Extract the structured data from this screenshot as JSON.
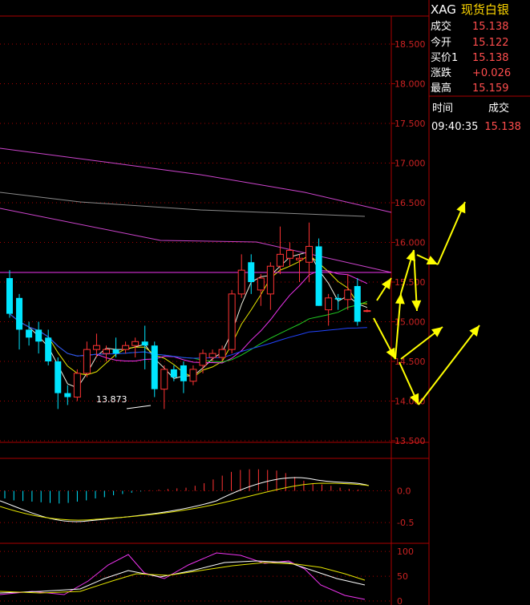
{
  "quote_panel": {
    "code": "XAG",
    "name": "现货白银",
    "fields": [
      {
        "label": "成交",
        "value": "15.138"
      },
      {
        "label": "今开",
        "value": "15.122"
      },
      {
        "label": "买价1",
        "value": "15.138"
      },
      {
        "label": "涨跌",
        "value": "+0.026"
      },
      {
        "label": "最高",
        "value": "15.159"
      }
    ],
    "ticks_header": {
      "time": "时间",
      "price": "成交"
    },
    "ticks": [
      {
        "time": "09:40:35",
        "price": "15.138"
      }
    ]
  },
  "colors": {
    "up": "#ff3333",
    "down": "#00e5ff",
    "grid": "#aa0000",
    "axis_text": "#cc2222",
    "ma_white": "#f0f0e0",
    "ma_yellow": "#e6e600",
    "ma_magenta": "#ee33ee",
    "ma_green": "#22cc22",
    "ma_blue": "#2244ff",
    "ma_gray": "#8a8a8a",
    "ma_pink": "#cc44cc",
    "arrow": "#ffff00"
  },
  "chart_data": [
    {
      "type": "candlestick",
      "yticks": [
        "18.500",
        "18.000",
        "17.500",
        "17.000",
        "16.500",
        "16.000",
        "15.500",
        "15.000",
        "14.500",
        "14.000",
        "13.500"
      ],
      "ylim": [
        13.5,
        18.5
      ],
      "annotation": "13.873",
      "candles": [
        {
          "o": 15.55,
          "h": 15.65,
          "l": 15.05,
          "c": 15.1
        },
        {
          "o": 15.3,
          "h": 15.35,
          "l": 14.65,
          "c": 14.9
        },
        {
          "o": 14.9,
          "h": 15.0,
          "l": 14.7,
          "c": 14.8
        },
        {
          "o": 14.9,
          "h": 15.0,
          "l": 14.6,
          "c": 14.75
        },
        {
          "o": 14.8,
          "h": 14.9,
          "l": 14.45,
          "c": 14.5
        },
        {
          "o": 14.5,
          "h": 14.55,
          "l": 13.9,
          "c": 14.1
        },
        {
          "o": 14.1,
          "h": 14.2,
          "l": 13.95,
          "c": 14.05
        },
        {
          "o": 14.05,
          "h": 14.4,
          "l": 14.0,
          "c": 14.35
        },
        {
          "o": 14.35,
          "h": 14.75,
          "l": 14.3,
          "c": 14.65
        },
        {
          "o": 14.65,
          "h": 14.85,
          "l": 14.55,
          "c": 14.7
        },
        {
          "o": 14.6,
          "h": 14.7,
          "l": 14.5,
          "c": 14.65
        },
        {
          "o": 14.65,
          "h": 14.8,
          "l": 14.55,
          "c": 14.6
        },
        {
          "o": 14.65,
          "h": 14.75,
          "l": 14.6,
          "c": 14.7
        },
        {
          "o": 14.7,
          "h": 14.8,
          "l": 14.55,
          "c": 14.75
        },
        {
          "o": 14.75,
          "h": 14.95,
          "l": 14.4,
          "c": 14.7
        },
        {
          "o": 14.7,
          "h": 14.75,
          "l": 14.05,
          "c": 14.15
        },
        {
          "o": 14.15,
          "h": 14.45,
          "l": 13.9,
          "c": 14.4
        },
        {
          "o": 14.4,
          "h": 14.45,
          "l": 14.25,
          "c": 14.3
        },
        {
          "o": 14.45,
          "h": 14.5,
          "l": 14.1,
          "c": 14.25
        },
        {
          "o": 14.25,
          "h": 14.45,
          "l": 14.2,
          "c": 14.4
        },
        {
          "o": 14.45,
          "h": 14.65,
          "l": 14.35,
          "c": 14.6
        },
        {
          "o": 14.55,
          "h": 14.65,
          "l": 14.5,
          "c": 14.6
        },
        {
          "o": 14.55,
          "h": 14.7,
          "l": 14.5,
          "c": 14.65
        },
        {
          "o": 14.65,
          "h": 15.4,
          "l": 14.6,
          "c": 15.35
        },
        {
          "o": 15.35,
          "h": 15.85,
          "l": 15.3,
          "c": 15.65
        },
        {
          "o": 15.75,
          "h": 15.85,
          "l": 15.35,
          "c": 15.5
        },
        {
          "o": 15.4,
          "h": 15.6,
          "l": 15.2,
          "c": 15.55
        },
        {
          "o": 15.35,
          "h": 15.75,
          "l": 15.15,
          "c": 15.7
        },
        {
          "o": 15.7,
          "h": 16.2,
          "l": 15.6,
          "c": 15.85
        },
        {
          "o": 15.8,
          "h": 16.0,
          "l": 15.7,
          "c": 15.9
        },
        {
          "o": 15.78,
          "h": 15.85,
          "l": 15.5,
          "c": 15.8
        },
        {
          "o": 15.75,
          "h": 16.25,
          "l": 15.5,
          "c": 15.95
        },
        {
          "o": 15.95,
          "h": 16.05,
          "l": 15.2,
          "c": 15.2
        },
        {
          "o": 15.15,
          "h": 15.35,
          "l": 14.95,
          "c": 15.3
        },
        {
          "o": 15.3,
          "h": 15.35,
          "l": 15.15,
          "c": 15.28
        },
        {
          "o": 15.28,
          "h": 15.6,
          "l": 15.15,
          "c": 15.4
        },
        {
          "o": 15.45,
          "h": 15.55,
          "l": 14.95,
          "c": 15.0
        },
        {
          "o": 15.13,
          "h": 15.16,
          "l": 15.12,
          "c": 15.14
        }
      ]
    },
    {
      "type": "bar",
      "yticks": [
        "0.0",
        "-0.5"
      ],
      "ylim": [
        -0.6,
        0.5
      ],
      "values": [
        -0.12,
        -0.15,
        -0.16,
        -0.17,
        -0.18,
        -0.19,
        -0.2,
        -0.19,
        -0.17,
        -0.15,
        -0.12,
        -0.1,
        -0.07,
        -0.05,
        -0.03,
        -0.01,
        0.01,
        0.02,
        0.03,
        0.04,
        0.05,
        0.08,
        0.12,
        0.18,
        0.24,
        0.3,
        0.33,
        0.34,
        0.34,
        0.33,
        0.32,
        0.28,
        0.22,
        0.16,
        0.12,
        0.1,
        0.08,
        0.05,
        0.03,
        0.02
      ]
    },
    {
      "type": "line",
      "yticks": [
        "100",
        "50",
        "0"
      ],
      "ylim": [
        0,
        110
      ]
    }
  ]
}
